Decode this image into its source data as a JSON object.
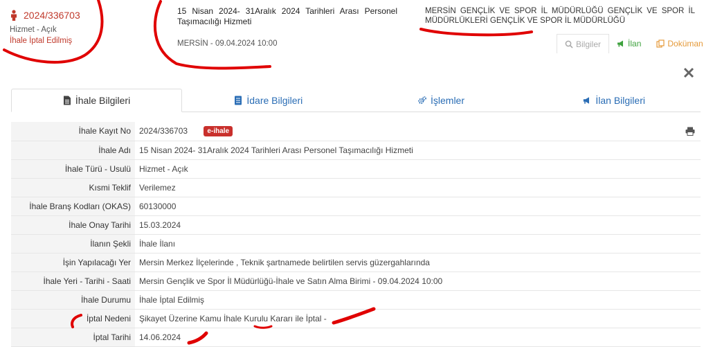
{
  "header": {
    "tender_no": "2024/336703",
    "type": "Hizmet - Açık",
    "status": "İhale İptal Edilmiş",
    "title": "15 Nisan 2024- 31Aralık 2024 Tarihleri Arası Personel Taşımacılığı Hizmeti",
    "city_date": "MERSİN - 09.04.2024 10:00",
    "authority": "MERSİN GENÇLİK VE SPOR İL MÜDÜRLÜĞÜ GENÇLİK VE SPOR İL MÜDÜRLÜKLERİ GENÇLİK VE SPOR İL MÜDÜRLÜĞÜ"
  },
  "mini_tabs": {
    "bilgiler": "Bilgiler",
    "ilan": "İlan",
    "dokuman": "Doküman"
  },
  "tabs": {
    "ihale": "İhale Bilgileri",
    "idare": "İdare Bilgileri",
    "islemler": "İşlemler",
    "ilan": "İlan Bilgileri"
  },
  "badge": "e-ihale",
  "rows": [
    {
      "label": "İhale Kayıt No",
      "value": "2024/336703"
    },
    {
      "label": "İhale Adı",
      "value": "15 Nisan 2024- 31Aralık 2024 Tarihleri Arası Personel Taşımacılığı Hizmeti"
    },
    {
      "label": "İhale Türü - Usulü",
      "value": "Hizmet - Açık"
    },
    {
      "label": "Kısmi Teklif",
      "value": "Verilemez"
    },
    {
      "label": "İhale Branş Kodları (OKAS)",
      "value": "60130000"
    },
    {
      "label": "İhale Onay Tarihi",
      "value": "15.03.2024"
    },
    {
      "label": "İlanın Şekli",
      "value": "İhale İlanı"
    },
    {
      "label": "İşin Yapılacağı Yer",
      "value": "Mersin Merkez İlçelerinde , Teknik şartnamede belirtilen servis güzergahlarında"
    },
    {
      "label": "İhale Yeri - Tarihi - Saati",
      "value": "Mersin Gençlik ve Spor İl Müdürlüğü-İhale ve Satın Alma Birimi - 09.04.2024 10:00"
    },
    {
      "label": "İhale Durumu",
      "value": "İhale İptal Edilmiş"
    },
    {
      "label": "İptal Nedeni",
      "value": "Şikayet Üzerine Kamu İhale Kurulu Kararı ile İptal -"
    },
    {
      "label": "İptal Tarihi",
      "value": "14.06.2024"
    }
  ],
  "colors": {
    "brand_red": "#c0392b",
    "link_blue": "#2a6db5",
    "ilan_green": "#3fa23f",
    "dokuman_orange": "#e59a3a",
    "annotation_red": "#e00000"
  }
}
